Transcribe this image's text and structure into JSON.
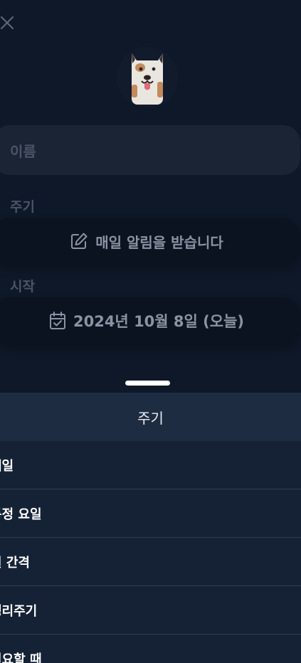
{
  "form": {
    "name_placeholder": "이름",
    "cycle_label": "주기",
    "cycle_value": "매일 알림을 받습니다",
    "start_label": "시작",
    "start_value": "2024년 10월 8일 (오늘)"
  },
  "sheet": {
    "title": "주기",
    "options": [
      {
        "label": "매일"
      },
      {
        "label": "특정 요일"
      },
      {
        "label": "일 간격"
      },
      {
        "label": "생리주기"
      },
      {
        "label": "필요할 때"
      }
    ]
  },
  "icons": {
    "close": "close-icon",
    "edit": "edit-icon",
    "calendar": "calendar-check-icon",
    "avatar": "dog-avatar"
  },
  "colors": {
    "background": "#0f1828",
    "sheet": "#152236",
    "sheet_header": "#1e2c42",
    "divider": "#2f3d52"
  }
}
